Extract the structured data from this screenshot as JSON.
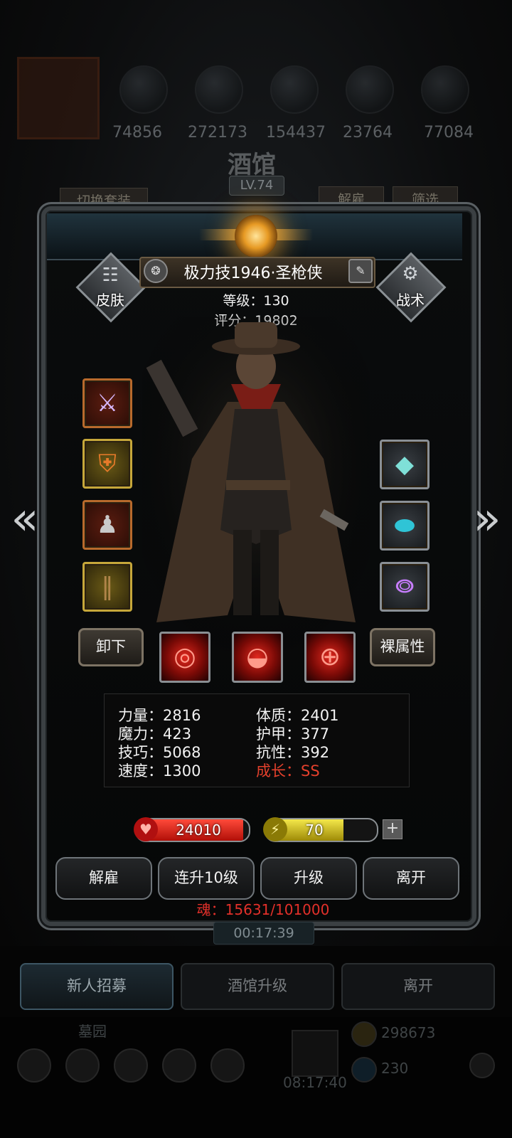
{
  "top_resources": [
    "74856",
    "272173",
    "154437",
    "23764",
    "77084"
  ],
  "tavern": {
    "title": "酒馆",
    "level": "LV.74"
  },
  "top_buttons": {
    "switch_outfit": "切换套装",
    "dismiss": "解雇",
    "filter": "筛选"
  },
  "hero": {
    "name": "极力技1946·圣枪侠",
    "level_line": "等级：130",
    "score_line": "评分：19802",
    "skin_label": "皮肤",
    "tactics_label": "战术"
  },
  "equipment": {
    "left": [
      "pistol",
      "armor",
      "helmet",
      "bracers"
    ],
    "right": [
      "gem",
      "stone",
      "lantern"
    ]
  },
  "action_row": {
    "unequip": "卸下",
    "base_attr": "裸属性"
  },
  "stats": {
    "strength": "力量：2816",
    "magic": "魔力：423",
    "skill": "技巧：5068",
    "speed": "速度：1300",
    "constitution": "体质：2401",
    "armor": "护甲：377",
    "resistance": "抗性：392",
    "growth": "成长：SS"
  },
  "bars": {
    "hp": "24010",
    "hp_fill": 0.95,
    "energy": "70",
    "energy_fill": 0.7
  },
  "actions": {
    "dismiss": "解雇",
    "level10": "连升10级",
    "upgrade": "升级",
    "leave": "离开"
  },
  "soul": "魂：15631/101000",
  "timer": "00:17:39",
  "tabs": {
    "recruit": "新人招募",
    "tavern_upgrade": "酒馆升级",
    "leave": "离开"
  },
  "bottom": {
    "area": "墓园",
    "timer": "08:17:40",
    "gold": "298673",
    "gem": "230"
  },
  "colors": {
    "hp": "#d8150c",
    "energy": "#e6d52c",
    "growth": "#e3402c",
    "soul": "#e3302a"
  }
}
